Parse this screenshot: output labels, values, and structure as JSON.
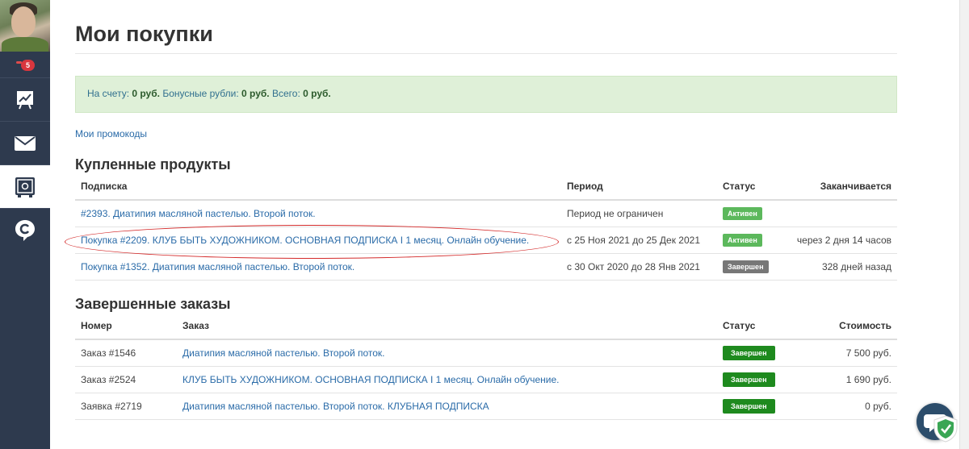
{
  "sidebar": {
    "notification_count": "5",
    "items": [
      {
        "icon": "chart-icon"
      },
      {
        "icon": "mail-icon"
      },
      {
        "icon": "safe-icon",
        "active": true
      },
      {
        "icon": "brand-icon"
      }
    ]
  },
  "page": {
    "title": "Мои покупки"
  },
  "balance": {
    "account_label": "На счету:",
    "account_value": "0 руб.",
    "bonus_label": "Бонусные рубли:",
    "bonus_value": "0 руб.",
    "total_label": "Всего:",
    "total_value": "0 руб."
  },
  "promo_link": "Мои промокоды",
  "purchased": {
    "title": "Купленные продукты",
    "headers": [
      "Подписка",
      "Период",
      "Статус",
      "Заканчивается"
    ],
    "rows": [
      {
        "name": "#2393. Диатипия масляной пастелью. Второй поток.",
        "period": "Период не ограничен",
        "status": "Активен",
        "ends": ""
      },
      {
        "name": "Покупка #2209. КЛУБ БЫТЬ ХУДОЖНИКОМ. ОСНОВНАЯ ПОДПИСКА I 1 месяц. Онлайн обучение.",
        "period": "с 25 Ноя 2021 до 25 Дек 2021",
        "status": "Активен",
        "ends": "через 2 дня 14 часов"
      },
      {
        "name": "Покупка #1352. Диатипия масляной пастелью. Второй поток.",
        "period": "с 30 Окт 2020 до 28 Янв 2021",
        "status": "Завершен",
        "ends": "328 дней назад"
      }
    ]
  },
  "orders": {
    "title": "Завершенные заказы",
    "headers": [
      "Номер",
      "Заказ",
      "Статус",
      "Стоимость"
    ],
    "rows": [
      {
        "number": "Заказ #1546",
        "order": "Диатипия масляной пастелью. Второй поток.",
        "status": "Завершен",
        "price": "7 500 руб."
      },
      {
        "number": "Заказ #2524",
        "order": "КЛУБ БЫТЬ ХУДОЖНИКОМ. ОСНОВНАЯ ПОДПИСКА I 1 месяц. Онлайн обучение.",
        "status": "Завершен",
        "price": "1 690 руб."
      },
      {
        "number": "Заявка #2719",
        "order": "Диатипия масляной пастелью. Второй поток. КЛУБНАЯ ПОДПИСКА",
        "status": "Завершен",
        "price": "0 руб."
      }
    ]
  },
  "colors": {
    "sidebar": "#2e3a4e",
    "link": "#2a6ba8",
    "balance_bg": "#dff0d8",
    "badge_active": "#5cb85c",
    "badge_done": "#1e8a1e",
    "highlight": "#d42a2a"
  }
}
